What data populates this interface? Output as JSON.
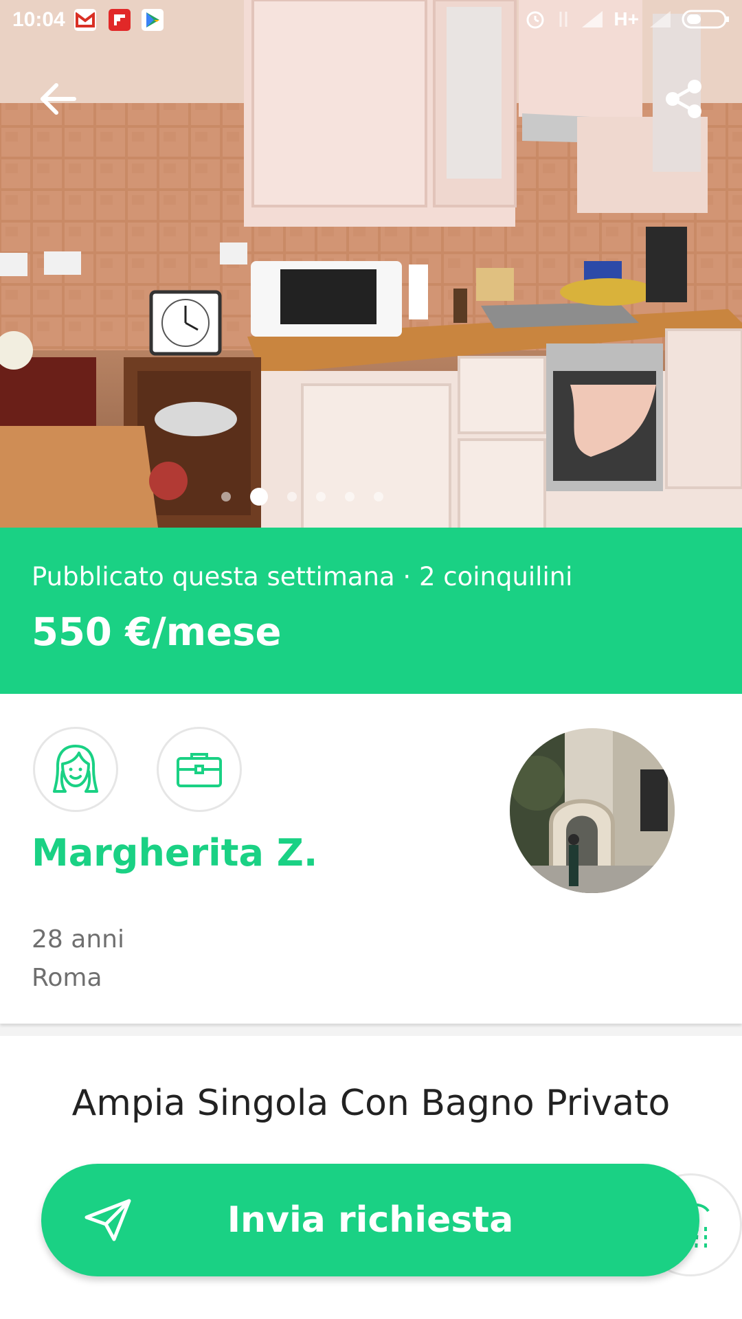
{
  "status_bar": {
    "time": "10:04",
    "network": "H+",
    "apps": [
      "gmail-icon",
      "flipboard-icon",
      "play-store-icon"
    ]
  },
  "hero": {
    "photo_subject": "kitchen",
    "active_dot": 1,
    "dot_count": 6
  },
  "banner": {
    "meta": "Pubblicato questa settimana · 2 coinquilini",
    "price": "550 €/mese"
  },
  "profile": {
    "name": "Margherita Z.",
    "age": "28 anni",
    "city": "Roma"
  },
  "listing": {
    "title": "Ampia Singola Con Bagno Privato"
  },
  "cta": {
    "label": "Invia richiesta"
  },
  "colors": {
    "accent": "#1ad184",
    "text_dark": "#222222",
    "text_muted": "#6f6f6f"
  }
}
